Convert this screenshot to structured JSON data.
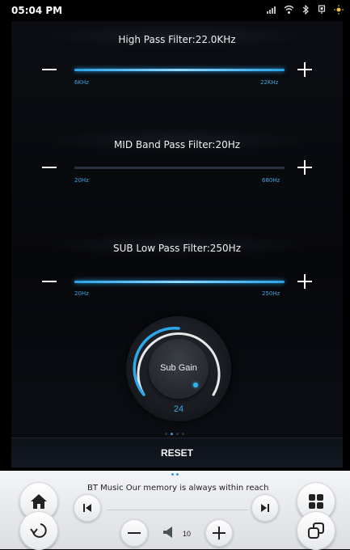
{
  "status": {
    "time": "05:04 PM"
  },
  "filters": [
    {
      "title": "High Pass Filter:22.0KHz",
      "min_label": "6KHz",
      "max_label": "22KHz",
      "level": 1.0
    },
    {
      "title": "MID Band Pass Filter:20Hz",
      "min_label": "20Hz",
      "max_label": "680Hz",
      "level": 0.0
    },
    {
      "title": "SUB Low Pass Filter:250Hz",
      "min_label": "20Hz",
      "max_label": "250Hz",
      "level": 1.0
    }
  ],
  "sub_gain": {
    "label": "Sub Gain",
    "value": "24"
  },
  "reset_label": "RESET",
  "player": {
    "track_text": "BT Music  Our memory is always within reach",
    "volume": "10"
  },
  "colors": {
    "accent": "#2e9de0"
  }
}
